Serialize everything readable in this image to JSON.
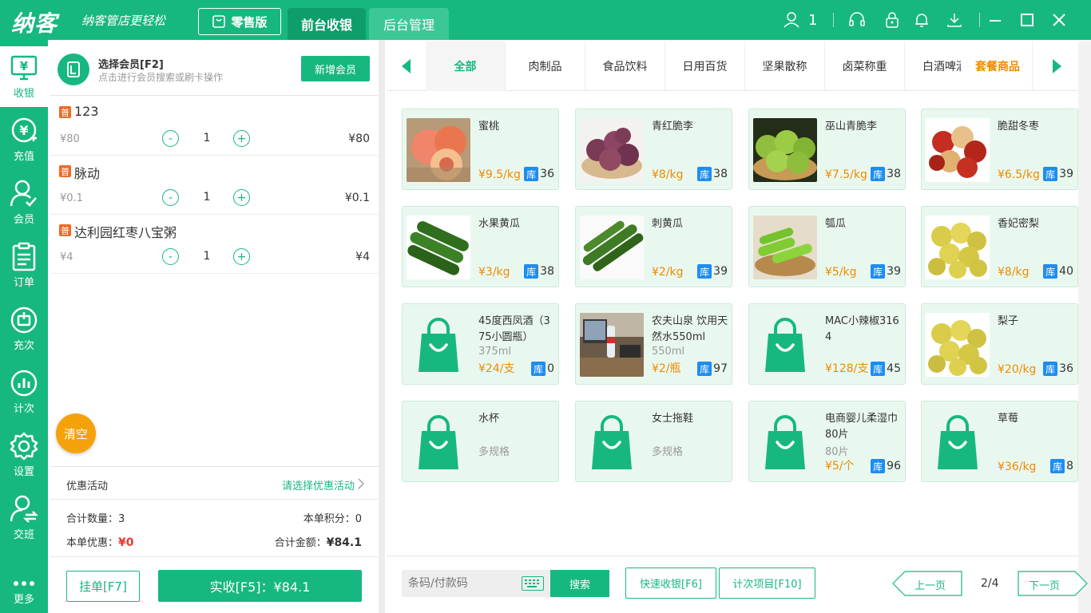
{
  "header": {
    "logo": "纳客",
    "slogan": "纳客管店更轻松",
    "edition": "零售版",
    "tabs": [
      {
        "label": "前台收银"
      },
      {
        "label": "后台管理"
      }
    ],
    "user_count": "1",
    "accent": "#17b87f"
  },
  "sidebar": {
    "items": [
      {
        "label": "收银",
        "icon": "cashier-icon"
      },
      {
        "label": "充值",
        "icon": "recharge-icon"
      },
      {
        "label": "会员",
        "icon": "member-icon"
      },
      {
        "label": "订单",
        "icon": "order-icon"
      },
      {
        "label": "充次",
        "icon": "recharge-times-icon"
      },
      {
        "label": "计次",
        "icon": "count-icon"
      },
      {
        "label": "设置",
        "icon": "gear-icon"
      },
      {
        "label": "交班",
        "icon": "handover-icon"
      },
      {
        "label": "更多",
        "icon": "more-icon"
      }
    ]
  },
  "member": {
    "title": "选择会员[F2]",
    "hint": "点击进行会员搜索或刷卡操作",
    "add_label": "新增会员"
  },
  "cart": {
    "items": [
      {
        "badge": "普",
        "name": "123",
        "price": "¥80",
        "qty": "1",
        "total": "¥80"
      },
      {
        "badge": "普",
        "name": "脉动",
        "price": "¥0.1",
        "qty": "1",
        "total": "¥0.1"
      },
      {
        "badge": "普",
        "name": "达利园红枣八宝粥",
        "price": "¥4",
        "qty": "1",
        "total": "¥4"
      }
    ],
    "clear_label": "清空",
    "minus": "-",
    "plus": "+"
  },
  "promotion": {
    "label": "优惠活动",
    "select": "请选择优惠活动"
  },
  "summary": {
    "count_label": "合计数量：",
    "count": "3",
    "points_label": "本单积分：",
    "points": "0",
    "discount_label": "本单优惠：",
    "discount": "¥0",
    "amount_label": "合计金额：",
    "amount": "¥84.1"
  },
  "actions": {
    "hang": "挂单[F7]",
    "pay": "实收[F5]：¥84.1"
  },
  "categories": {
    "items": [
      "全部",
      "肉制品",
      "食品饮料",
      "日用百货",
      "坚果散称",
      "卤菜称重",
      "白酒啤酒"
    ],
    "combo": "套餐商品"
  },
  "products": [
    {
      "name": "蜜桃",
      "spec": "",
      "price": "¥9.5/kg",
      "stock_label": "库",
      "stock": "36",
      "image": "peach-image"
    },
    {
      "name": "青红脆李",
      "spec": "",
      "price": "¥8/kg",
      "stock_label": "库",
      "stock": "38",
      "image": "plum-image"
    },
    {
      "name": "巫山青脆李",
      "spec": "",
      "price": "¥7.5/kg",
      "stock_label": "库",
      "stock": "38",
      "image": "green-plum-image"
    },
    {
      "name": "脆甜冬枣",
      "spec": "",
      "price": "¥6.5/kg",
      "stock_label": "库",
      "stock": "39",
      "image": "jujube-image"
    },
    {
      "name": "水果黄瓜",
      "spec": "",
      "price": "¥3/kg",
      "stock_label": "库",
      "stock": "38",
      "image": "cucumber-image"
    },
    {
      "name": "刺黄瓜",
      "spec": "",
      "price": "¥2/kg",
      "stock_label": "库",
      "stock": "39",
      "image": "thorn-cucumber-image"
    },
    {
      "name": "瓠瓜",
      "spec": "",
      "price": "¥5/kg",
      "stock_label": "库",
      "stock": "39",
      "image": "gourd-image"
    },
    {
      "name": "香妃密梨",
      "spec": "",
      "price": "¥8/kg",
      "stock_label": "库",
      "stock": "40",
      "image": "pear-image"
    },
    {
      "name": "45度西凤酒（375小圆瓶）",
      "spec": "375ml",
      "price": "¥24/支",
      "stock_label": "库",
      "stock": "0",
      "image": "bag-icon"
    },
    {
      "name": "农夫山泉 饮用天然水550ml",
      "spec": "550ml",
      "price": "¥2/瓶",
      "stock_label": "库",
      "stock": "97",
      "image": "water-photo-image"
    },
    {
      "name": "MAC小辣椒3164",
      "spec": "",
      "price": "¥128/支",
      "stock_label": "库",
      "stock": "45",
      "image": "bag-icon"
    },
    {
      "name": "梨子",
      "spec": "",
      "price": "¥20/kg",
      "stock_label": "库",
      "stock": "36",
      "image": "pear-image"
    },
    {
      "name": "水杯",
      "spec": "多规格",
      "price": "",
      "stock_label": "",
      "stock": "",
      "image": "bag-icon"
    },
    {
      "name": "女士拖鞋",
      "spec": "多规格",
      "price": "",
      "stock_label": "",
      "stock": "",
      "image": "bag-icon"
    },
    {
      "name": "电商婴儿柔湿巾80片",
      "spec": "80片",
      "price": "¥5/个",
      "stock_label": "库",
      "stock": "96",
      "image": "bag-icon"
    },
    {
      "name": "草莓",
      "spec": "",
      "price": "¥36/kg",
      "stock_label": "库",
      "stock": "8",
      "image": "bag-icon"
    }
  ],
  "footer": {
    "search_placeholder": "条码/付款码",
    "search_btn": "搜索",
    "quick_btn": "快速收银[F6]",
    "count_btn": "计次项目[F10]",
    "prev": "上一页",
    "page": "2/4",
    "next": "下一页"
  }
}
